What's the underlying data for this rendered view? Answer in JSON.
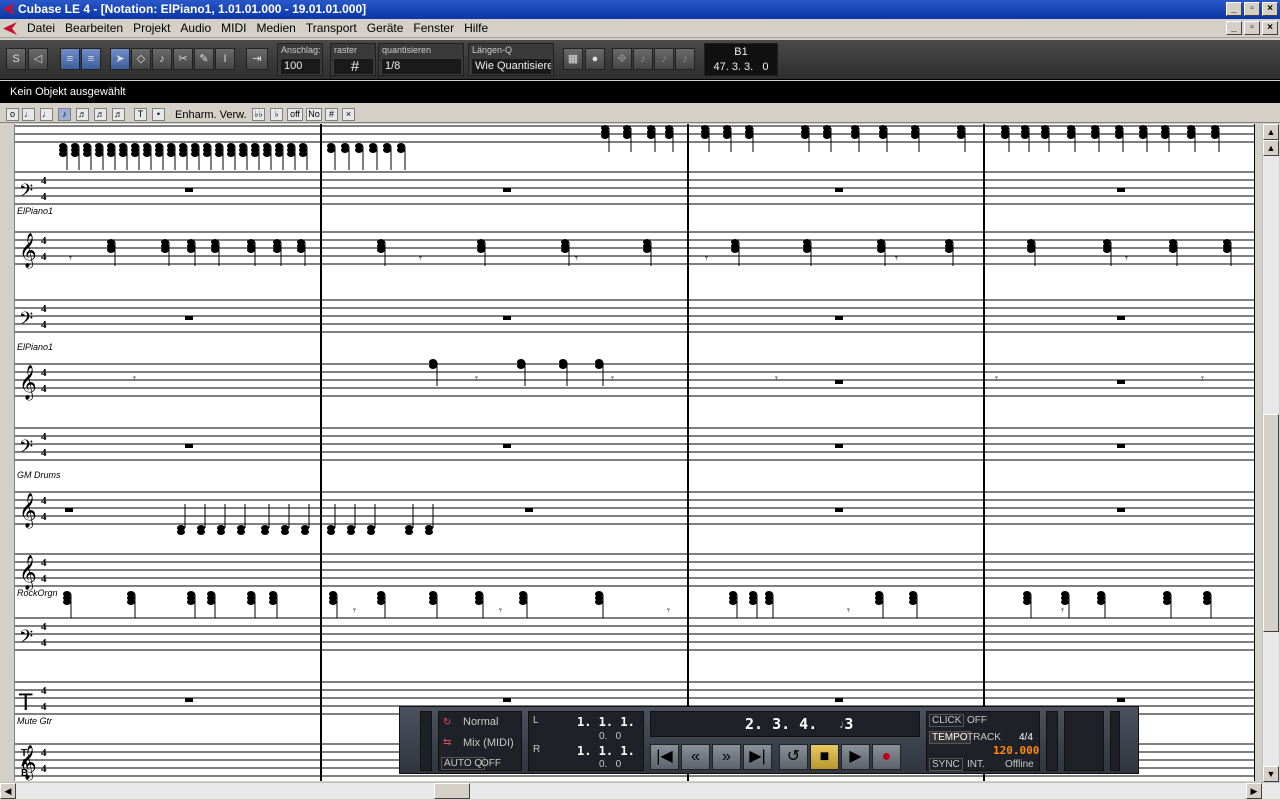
{
  "window": {
    "title": "Cubase LE 4 - [Notation: ElPiano1, 1.01.01.000 - 19.01.01.000]"
  },
  "menu": [
    "Datei",
    "Bearbeiten",
    "Projekt",
    "Audio",
    "MIDI",
    "Medien",
    "Transport",
    "Geräte",
    "Fenster",
    "Hilfe"
  ],
  "toolbar": {
    "velocity_label": "Anschlag:",
    "velocity_value": "100",
    "grid_label": "raster",
    "quantize_label": "quantisieren",
    "quantize_value": "1/8",
    "length_label": "Längen-Q",
    "length_value": "Wie Quantisieren",
    "position_top": "B1",
    "position_bottom": "47. 3. 3.   0"
  },
  "status": "Kein Objekt ausgewählt",
  "notebar": {
    "enharm_label": "Enharm. Verw.",
    "off": "off",
    "no": "No",
    "sharp": "#",
    "t": "T"
  },
  "tracks": [
    "ElPiano1",
    "ElPiano1",
    "GM Drums",
    "RockOrgn",
    "Mute Gtr"
  ],
  "transport": {
    "mode": "Normal",
    "mix": "Mix (MIDI)",
    "autoq_label": "AUTO Q",
    "autoq_value": "OFF",
    "left_locator": "1. 1. 1.   0",
    "left_sub": "0.   0",
    "right_locator": "1. 1. 1.   0",
    "right_sub": "0.   0",
    "position": "2. 3. 4.   3",
    "click_label": "CLICK",
    "click_value": "OFF",
    "tempo_label": "TEMPO",
    "track_label": "TRACK",
    "signature": "4/4",
    "tempo": "120.000",
    "sync_label": "SYNC",
    "int_label": "INT.",
    "sync_value": "Offline"
  }
}
